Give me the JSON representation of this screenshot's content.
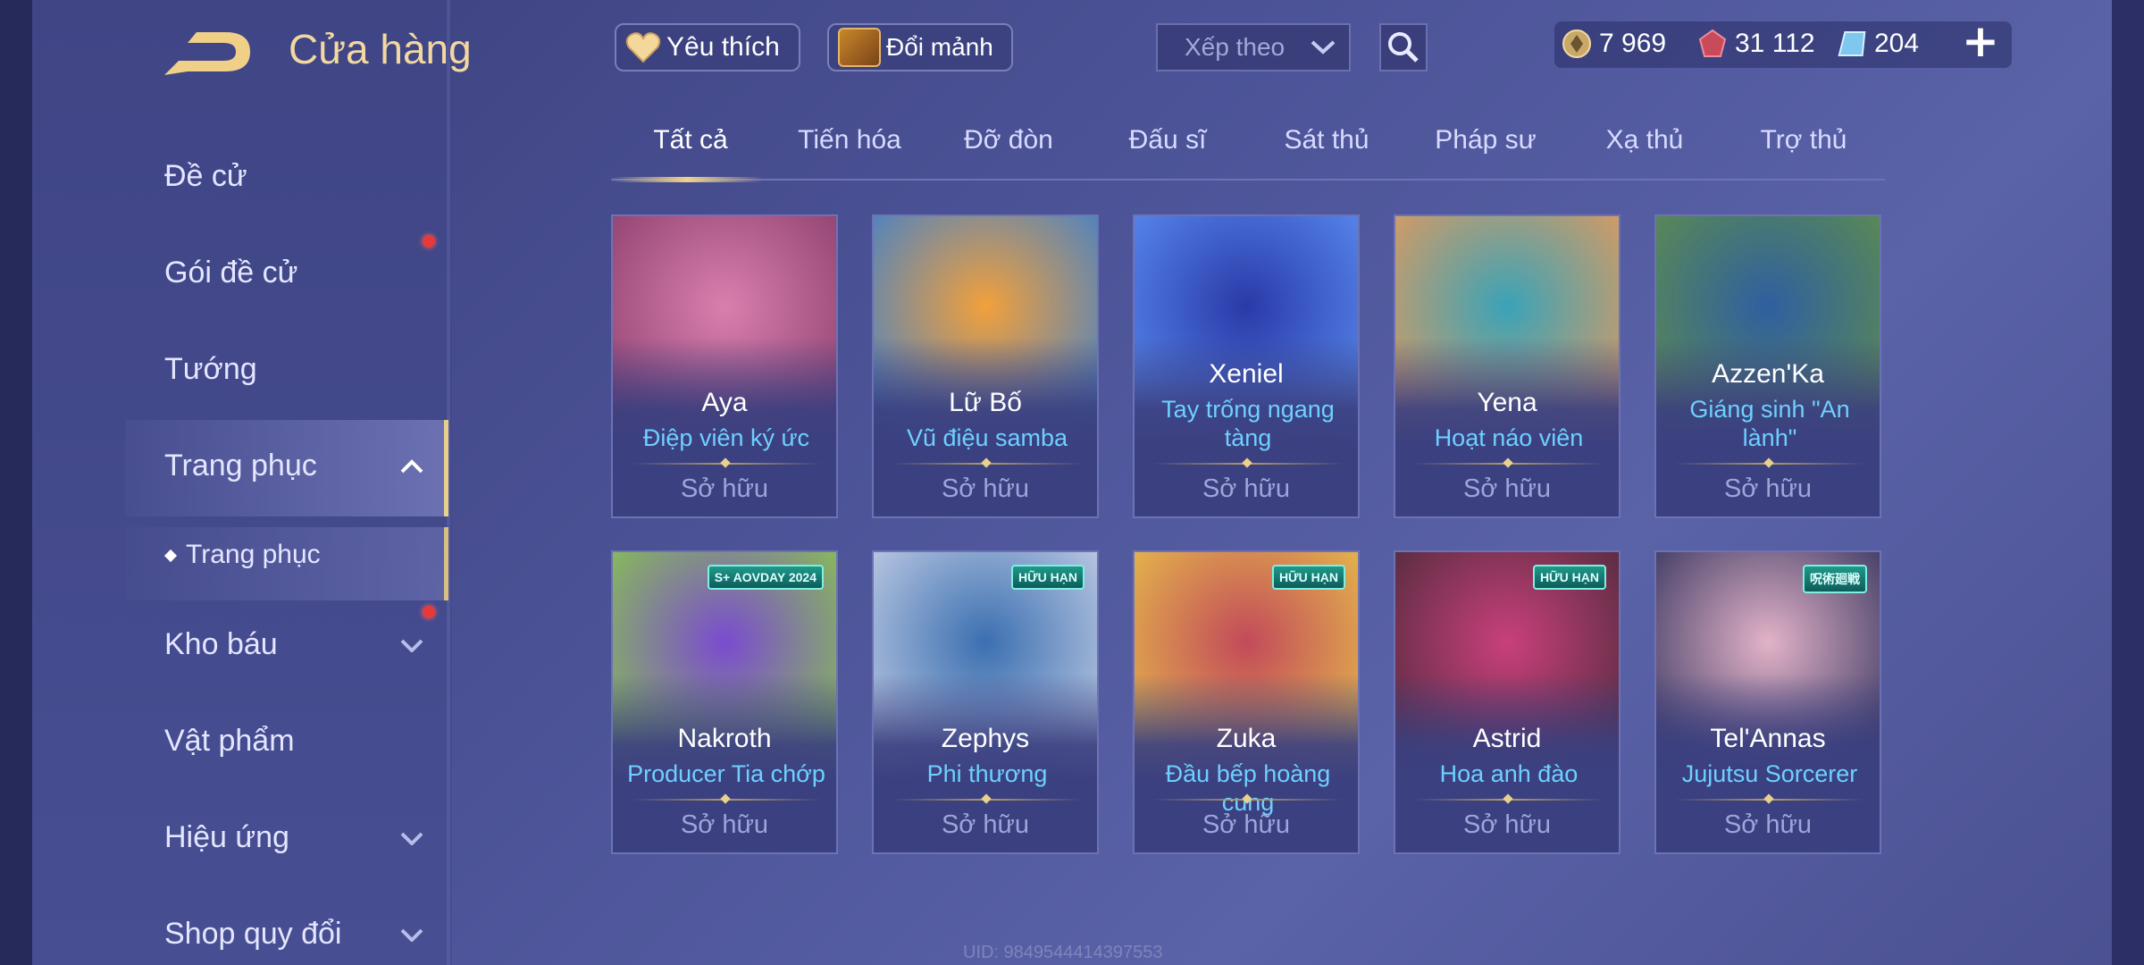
{
  "header": {
    "title": "Cửa hàng",
    "favorites_label": "Yêu thích",
    "fragments_label": "Đổi mảnh",
    "sort_label": "Xếp theo",
    "currencies": [
      {
        "icon": "gold-coin-icon",
        "value": "7 969"
      },
      {
        "icon": "red-gem-icon",
        "value": "31 112"
      },
      {
        "icon": "voucher-icon",
        "value": "204"
      }
    ],
    "plus_label": "+"
  },
  "sidebar": {
    "items": [
      {
        "label": "Đề cử"
      },
      {
        "label": "Gói đề cử"
      },
      {
        "label": "Tướng"
      },
      {
        "label": "Trang phục"
      },
      {
        "label": "Trang phục"
      },
      {
        "label": "Kho báu"
      },
      {
        "label": "Vật phẩm"
      },
      {
        "label": "Hiệu ứng"
      },
      {
        "label": "Shop quy đổi"
      }
    ]
  },
  "tabs": [
    "Tất cả",
    "Tiến hóa",
    "Đỡ đòn",
    "Đấu sĩ",
    "Sát thủ",
    "Pháp sư",
    "Xạ thủ",
    "Trợ thủ"
  ],
  "cards": [
    {
      "hero": "Aya",
      "skin": "Điệp viên ký ức",
      "status": "Sở hữu",
      "palette": [
        "#d97fae",
        "#8a3d6b"
      ]
    },
    {
      "hero": "Lữ Bố",
      "skin": "Vũ điệu samba",
      "status": "Sở hữu",
      "palette": [
        "#f2a03b",
        "#3a7fd0"
      ]
    },
    {
      "hero": "Xeniel",
      "skin": "Tay trống ngang tàng",
      "status": "Sở hữu",
      "palette": [
        "#2a3aa8",
        "#5b8ff2"
      ]
    },
    {
      "hero": "Yena",
      "skin": "Hoạt náo viên",
      "status": "Sở hữu",
      "palette": [
        "#3aa3b8",
        "#e89a5a"
      ]
    },
    {
      "hero": "Azzen'Ka",
      "skin": "Giáng sinh \"An lành\"",
      "status": "Sở hữu",
      "palette": [
        "#2f5fa0",
        "#5f8f4a"
      ]
    },
    {
      "hero": "Nakroth",
      "skin": "Producer Tia chớp",
      "status": "Sở hữu",
      "palette": [
        "#7a4bd0",
        "#8ac94a"
      ],
      "badge_text": "S+ AOVDAY 2024"
    },
    {
      "hero": "Zephys",
      "skin": "Phi thương",
      "status": "Sở hữu",
      "palette": [
        "#3b6fb0",
        "#c9d2e8"
      ],
      "badge_text": "HỮU HẠN"
    },
    {
      "hero": "Zuka",
      "skin": "Đầu bếp hoàng cung",
      "status": "Sở hữu",
      "palette": [
        "#c24a5a",
        "#e8c24a"
      ],
      "badge_text": "HỮU HẠN"
    },
    {
      "hero": "Astrid",
      "skin": "Hoa anh đào",
      "status": "Sở hữu",
      "palette": [
        "#c9407a",
        "#4a2a3a"
      ],
      "badge_text": "HỮU HẠN"
    },
    {
      "hero": "Tel'Annas",
      "skin": "Jujutsu Sorcerer",
      "status": "Sở hữu",
      "palette": [
        "#e2b3c8",
        "#2f2f5a"
      ],
      "badge_text": "呪術廻戦"
    }
  ],
  "footer": {
    "uid": "UID: 9849544414397553"
  },
  "colors": {
    "accent_gold": "#e9cf8e",
    "skin_text": "#6ed0ff",
    "notify_red": "#e53a3a"
  }
}
